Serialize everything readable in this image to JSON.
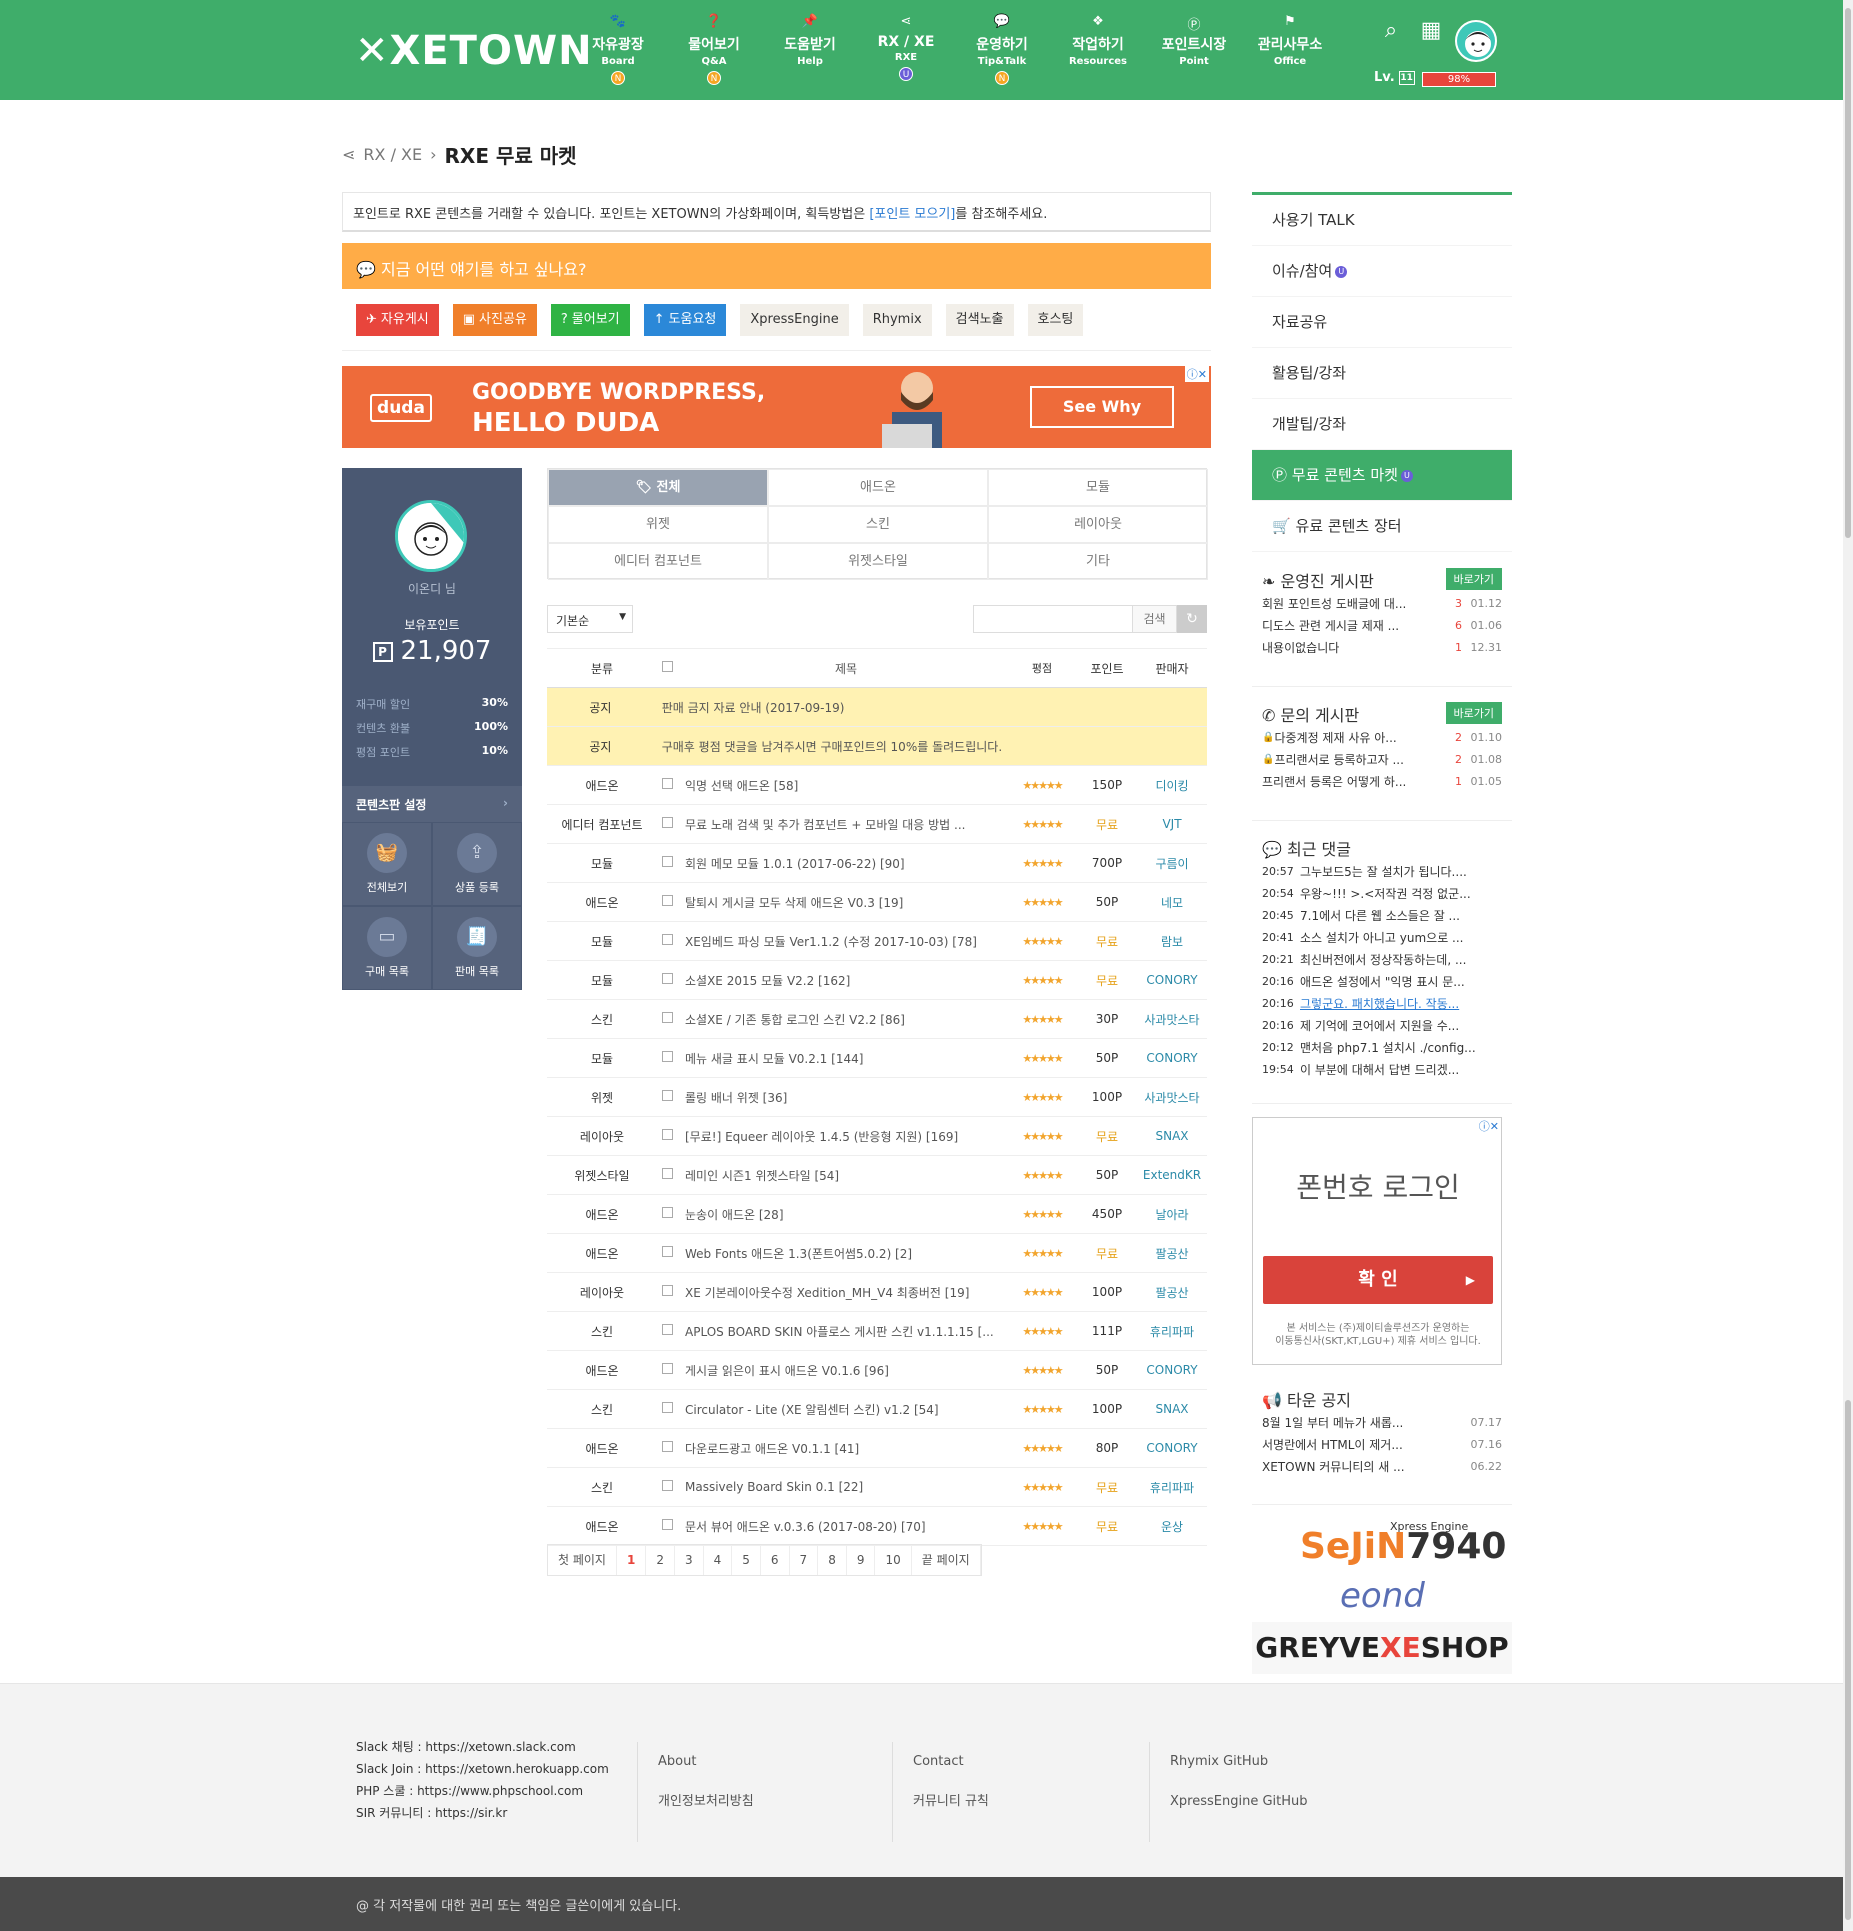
{
  "header": {
    "logo": "XETOWN",
    "menu": [
      {
        "icon": "cat-icon",
        "title": "자유광장",
        "sub": "Board",
        "badge": "N",
        "badge_color": "orange"
      },
      {
        "icon": "question-icon",
        "title": "물어보기",
        "sub": "Q&A",
        "badge": "N",
        "badge_color": "orange"
      },
      {
        "icon": "pin-icon",
        "title": "도움받기",
        "sub": "Help",
        "badge": "",
        "badge_color": ""
      },
      {
        "icon": "share-icon",
        "title": "RX / XE",
        "sub": "RXE",
        "badge": "U",
        "badge_color": "purple"
      },
      {
        "icon": "chat-icon",
        "title": "운영하기",
        "sub": "Tip&Talk",
        "badge": "N",
        "badge_color": "orange"
      },
      {
        "icon": "cubes-icon",
        "title": "작업하기",
        "sub": "Resources",
        "badge": "",
        "badge_color": ""
      },
      {
        "icon": "point-icon",
        "title": "포인트시장",
        "sub": "Point",
        "badge": "",
        "badge_color": ""
      },
      {
        "icon": "flag-icon",
        "title": "관리사무소",
        "sub": "Office",
        "badge": "",
        "badge_color": ""
      }
    ],
    "level_label": "Lv.",
    "level_value": "11",
    "exp": "98%"
  },
  "breadcrumb": {
    "parent": "RX / XE",
    "sep": "›",
    "current": "RXE 무료 마켓"
  },
  "notice": {
    "pre": "포인트로 RXE 콘텐츠를 거래할 수 있습니다. 포인트는 XETOWN의 가상화페이며, 획득방법은 ",
    "link": "[포인트 모으기]",
    "post": "를 참조해주세요."
  },
  "talk": {
    "text": "지금 어떤 얘기를 하고 싶나요?"
  },
  "quick": [
    {
      "label": "자유게시",
      "color": "red",
      "icon": "✈"
    },
    {
      "label": "사진공유",
      "color": "orange",
      "icon": "▣"
    },
    {
      "label": "물어보기",
      "color": "green",
      "icon": "?"
    },
    {
      "label": "도움요청",
      "color": "blue",
      "icon": "↑"
    },
    {
      "label": "XpressEngine",
      "color": "gray",
      "icon": ""
    },
    {
      "label": "Rhymix",
      "color": "gray",
      "icon": ""
    },
    {
      "label": "검색노출",
      "color": "gray",
      "icon": ""
    },
    {
      "label": "호스팅",
      "color": "gray",
      "icon": ""
    }
  ],
  "ad1": {
    "brand": "duda",
    "line1": "GOODBYE WORDPRESS,",
    "line2": "HELLO DUDA",
    "cta": "See Why"
  },
  "profile": {
    "nick": "이온디 님",
    "point_label": "보유포인트",
    "point_badge": "P",
    "point": "21,907",
    "stats": [
      {
        "k": "재구매 할인",
        "v": "30%"
      },
      {
        "k": "컨텐츠 환불",
        "v": "100%"
      },
      {
        "k": "평점 포인트",
        "v": "10%"
      }
    ],
    "settings": "콘텐츠판 설정",
    "actions": [
      {
        "icon": "basket-icon",
        "label": "전체보기"
      },
      {
        "icon": "upload-icon",
        "label": "상품 등록"
      },
      {
        "icon": "card-icon",
        "label": "구매 목록"
      },
      {
        "icon": "receipt-icon",
        "label": "판매 목록"
      }
    ]
  },
  "categories": [
    "전체",
    "애드온",
    "모듈",
    "위젯",
    "스킨",
    "레이아웃",
    "에디터 컴포넌트",
    "위젯스타일",
    "기타"
  ],
  "filter": {
    "sort": "기본순",
    "search_btn": "검색",
    "search_placeholder": ""
  },
  "list": {
    "headers": {
      "cat": "분류",
      "title": "제목",
      "rating": "평점",
      "point": "포인트",
      "seller": "판매자"
    },
    "notices": [
      {
        "cat": "공지",
        "title": "판매 금지 자료 안내 (2017-09-19)"
      },
      {
        "cat": "공지",
        "title": "구매후 평점 댓글을 남겨주시면 구매포인트의 10%를 돌려드립니다."
      }
    ],
    "rows": [
      {
        "cat": "애드온",
        "title": "익명 선택 애드온 [58]",
        "rating": "★★★★★",
        "point": "150P",
        "seller": "디이킹",
        "free": false
      },
      {
        "cat": "에디터 컴포넌트",
        "title": "무료 노래 검색 및 추가 컴포넌트 + 모바일 대응 방법 ...",
        "rating": "★★★★★",
        "point": "무료",
        "seller": "VJT",
        "free": true
      },
      {
        "cat": "모듈",
        "title": "회원 메모 모듈 1.0.1 (2017-06-22) [90]",
        "rating": "★★★★★",
        "point": "700P",
        "seller": "구름이",
        "free": false
      },
      {
        "cat": "애드온",
        "title": "탈퇴시 게시글 모두 삭제 애드온 V0.3 [19]",
        "rating": "★★★★★",
        "point": "50P",
        "seller": "네모",
        "free": false
      },
      {
        "cat": "모듈",
        "title": "XE임베드 파싱 모듈 Ver1.1.2 (수정 2017-10-03) [78]",
        "rating": "★★★★★",
        "point": "무료",
        "seller": "람보",
        "free": true
      },
      {
        "cat": "모듈",
        "title": "소셜XE 2015 모듈 V2.2 [162]",
        "rating": "★★★★★",
        "point": "무료",
        "seller": "CONORY",
        "free": true
      },
      {
        "cat": "스킨",
        "title": "소셜XE / 기존 통합 로그인 스킨 V2.2 [86]",
        "rating": "★★★★★",
        "point": "30P",
        "seller": "사과맛스타",
        "free": false
      },
      {
        "cat": "모듈",
        "title": "메뉴 새글 표시 모듈 V0.2.1 [144]",
        "rating": "★★★★★",
        "point": "50P",
        "seller": "CONORY",
        "free": false
      },
      {
        "cat": "위젯",
        "title": "롤링 배너 위젯 [36]",
        "rating": "★★★★★",
        "point": "100P",
        "seller": "사과맛스타",
        "free": false
      },
      {
        "cat": "레이아웃",
        "title": "[무료!] Equeer 레이아웃 1.4.5 (반응형 지원) [169]",
        "rating": "★★★★★",
        "point": "무료",
        "seller": "SNAX",
        "free": true
      },
      {
        "cat": "위젯스타일",
        "title": "레미인 시즌1 위젯스타일 [54]",
        "rating": "★★★★★",
        "point": "50P",
        "seller": "ExtendKR",
        "free": false
      },
      {
        "cat": "애드온",
        "title": "눈송이 애드온 [28]",
        "rating": "★★★★★",
        "point": "450P",
        "seller": "날아라",
        "free": false
      },
      {
        "cat": "애드온",
        "title": "Web Fonts 애드온 1.3(폰트어썸5.0.2) [2]",
        "rating": "★★★★★",
        "point": "무료",
        "seller": "팔공산",
        "free": true
      },
      {
        "cat": "레이아웃",
        "title": "XE 기본레이아웃수정 Xedition_MH_V4 최종버전 [19]",
        "rating": "★★★★★",
        "point": "100P",
        "seller": "팔공산",
        "free": false
      },
      {
        "cat": "스킨",
        "title": "APLOS BOARD SKIN 아플로스 게시판 스킨 v1.1.1.15 [...",
        "rating": "★★★★★",
        "point": "111P",
        "seller": "휴리파파",
        "free": false
      },
      {
        "cat": "애드온",
        "title": "게시글 읽은이 표시 애드온 V0.1.6 [96]",
        "rating": "★★★★★",
        "point": "50P",
        "seller": "CONORY",
        "free": false
      },
      {
        "cat": "스킨",
        "title": "Circulator - Lite (XE 알림센터 스킨) v1.2 [54]",
        "rating": "★★★★★",
        "point": "100P",
        "seller": "SNAX",
        "free": false
      },
      {
        "cat": "애드온",
        "title": "다운로드광고 애드온 V0.1.1 [41]",
        "rating": "★★★★★",
        "point": "80P",
        "seller": "CONORY",
        "free": false
      },
      {
        "cat": "스킨",
        "title": "Massively Board Skin 0.1 [22]",
        "rating": "★★★★★",
        "point": "무료",
        "seller": "휴리파파",
        "free": true
      },
      {
        "cat": "애드온",
        "title": "문서 뷰어 애드온 v.0.3.6 (2017-08-20) [70]",
        "rating": "★★★★★",
        "point": "무료",
        "seller": "운상",
        "free": true
      }
    ]
  },
  "pager": {
    "first": "첫 페이지",
    "pages": [
      "1",
      "2",
      "3",
      "4",
      "5",
      "6",
      "7",
      "8",
      "9",
      "10"
    ],
    "last": "끝 페이지"
  },
  "sidemenu": [
    {
      "label": "사용기 TALK",
      "badge": ""
    },
    {
      "label": "이슈/참여",
      "badge": "U"
    },
    {
      "label": "자료공유",
      "badge": ""
    },
    {
      "label": "활용팁/강좌",
      "badge": ""
    },
    {
      "label": "개발팁/강좌",
      "badge": ""
    },
    {
      "label": "무료 콘텐츠 마켓",
      "badge": "U",
      "active": true
    },
    {
      "label": "유료 콘텐츠 장터",
      "badge": ""
    }
  ],
  "box_staff": {
    "title": "운영진 게시판",
    "go": "바로가기",
    "items": [
      {
        "t": "회원 포인트성 도배글에 대...",
        "n": "3",
        "d": "01.12"
      },
      {
        "t": "디도스 관련 게시글 제재 ...",
        "n": "6",
        "d": "01.06"
      },
      {
        "t": "내용이없습니다",
        "n": "1",
        "d": "12.31"
      }
    ]
  },
  "box_qa": {
    "title": "문의 게시판",
    "go": "바로가기",
    "items": [
      {
        "t": "다중계정 제재 사유 아...",
        "n": "2",
        "d": "01.10"
      },
      {
        "t": "프리랜서로 등록하고자 ...",
        "n": "2",
        "d": "01.08"
      },
      {
        "t": "프리랜서 등록은 어떻게 하...",
        "n": "1",
        "d": "01.05"
      }
    ]
  },
  "box_comments": {
    "title": "최근 댓글",
    "items": [
      {
        "tm": "20:57",
        "t": "그누보드5는 잘 설치가 됩니다...."
      },
      {
        "tm": "20:54",
        "t": "우왕~!!! >.<저작권 걱정 없군..."
      },
      {
        "tm": "20:45",
        "t": "7.1에서 다른 웹 소스들은 잘 ..."
      },
      {
        "tm": "20:41",
        "t": "소스 설치가 아니고 yum으로 ..."
      },
      {
        "tm": "20:21",
        "t": "최신버전에서 정상작동하는데, ..."
      },
      {
        "tm": "20:16",
        "t": "애드온 설정에서 \"익명 표시 문..."
      },
      {
        "tm": "20:16",
        "t": "그렇군요. 패치했습니다. 작동..."
      },
      {
        "tm": "20:16",
        "t": "제 기억에 코어에서 지원을 수..."
      },
      {
        "tm": "20:12",
        "t": "맨처음 php7.1 설치시 ./config..."
      },
      {
        "tm": "19:54",
        "t": "이 부분에 대해서 답변 드리겠..."
      }
    ]
  },
  "ad2": {
    "title": "폰번호 로그인",
    "btn": "확 인",
    "foot1": "본 서비스는 (주)제이티솔루션즈가 운영하는",
    "foot2": "이동통신사(SKT,KT,LGU+) 제휴 서비스 입니다."
  },
  "box_town": {
    "title": "타운 공지",
    "items": [
      {
        "t": "8월 1일 부터 메뉴가 새롭...",
        "d": "07.17"
      },
      {
        "t": "서명란에서 HTML이 제거...",
        "d": "07.16"
      },
      {
        "t": "XETOWN 커뮤니티의 새 ...",
        "d": "06.22"
      }
    ]
  },
  "banners": {
    "xe": "Xpress Engine",
    "sejin": "SeJiN",
    "sejin2": "7940",
    "eond": "eond",
    "greyve_a": "GREYVE",
    "greyve_b": "XE",
    "greyve_c": "SHOP"
  },
  "footer": {
    "links": [
      {
        "k": "Slack 채팅 : ",
        "v": "https://xetown.slack.com"
      },
      {
        "k": "Slack Join : ",
        "v": "https://xetown.herokuapp.com"
      },
      {
        "k": "PHP 스쿨 : ",
        "v": "https://www.phpschool.com"
      },
      {
        "k": "SIR 커뮤니티 : ",
        "v": "https://sir.kr"
      }
    ],
    "col1": [
      "About",
      "개인정보처리방침"
    ],
    "col2": [
      "Contact",
      "커뮤니티 규칙"
    ],
    "col3": [
      "Rhymix GitHub",
      "XpressEngine GitHub"
    ],
    "copyright": "@ 각 저작물에 대한 권리 또는 책임은 글쓴이에게 있습니다."
  },
  "colors": {
    "brand": "#3fad6a",
    "accent": "#ffac47",
    "danger": "#e8453c",
    "panel": "#4a5872"
  }
}
